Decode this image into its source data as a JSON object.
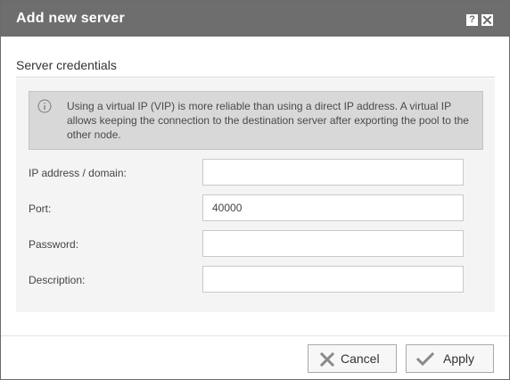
{
  "dialog": {
    "title": "Add new server",
    "help_icon_glyph": "?",
    "close_icon": "close-icon"
  },
  "section": {
    "title": "Server credentials"
  },
  "info": {
    "icon": "info-icon",
    "text": "Using a virtual IP (VIP) is more reliable than using a direct IP address. A virtual IP allows keeping the connection to the destination server after exporting the pool to the other node."
  },
  "fields": {
    "ip": {
      "label": "IP address / domain:",
      "value": ""
    },
    "port": {
      "label": "Port:",
      "value": "40000"
    },
    "password": {
      "label": "Password:",
      "value": ""
    },
    "description": {
      "label": "Description:",
      "value": ""
    }
  },
  "buttons": {
    "cancel": {
      "label": "Cancel",
      "icon": "x-icon"
    },
    "apply": {
      "label": "Apply",
      "icon": "checkmark-icon"
    }
  },
  "colors": {
    "titlebar": "#6e6e6e",
    "panel": "#f4f4f4",
    "info_box": "#d8d8d8"
  }
}
